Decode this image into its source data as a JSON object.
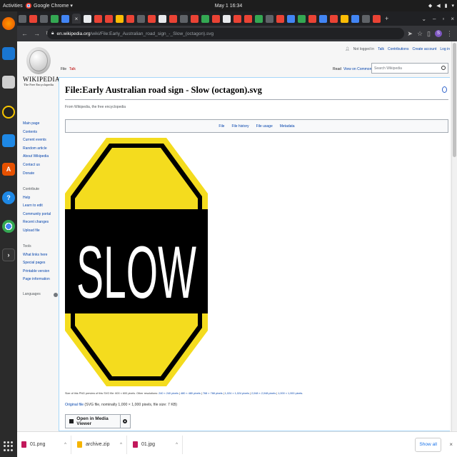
{
  "system": {
    "activities": "Activities",
    "app_name": "Google Chrome ▾",
    "clock": "May 1  16:34"
  },
  "browser": {
    "active_tab_close": "×",
    "new_tab": "+",
    "url_host": "en.wikipedia.org",
    "url_path": "/wiki/File:Early_Australian_road_sign_-_Slow_(octagon).svg",
    "profile_initial": "S"
  },
  "wiki": {
    "wordmark": "WIKIPEDIA",
    "tagline": "The Free Encyclopedia",
    "nav": [
      "Main page",
      "Contents",
      "Current events",
      "Random article",
      "About Wikipedia",
      "Contact us",
      "Donate"
    ],
    "contribute_heading": "Contribute",
    "contribute": [
      "Help",
      "Learn to edit",
      "Community portal",
      "Recent changes",
      "Upload file"
    ],
    "tools_heading": "Tools",
    "tools": [
      "What links here",
      "Special pages",
      "Printable version",
      "Page information"
    ],
    "languages_heading": "Languages",
    "personal": {
      "not_logged_in": "Not logged in",
      "talk": "Talk",
      "contributions": "Contributions",
      "create_account": "Create account",
      "log_in": "Log in"
    },
    "tab_file": "File",
    "tab_talk": "Talk",
    "tab_read": "Read",
    "tab_view_commons": "View on Commons",
    "search_placeholder": "Search Wikipedia",
    "title": "File:Early Australian road sign - Slow (octagon).svg",
    "from_line": "From Wikipedia, the free encyclopedia",
    "file_nav": [
      "File",
      "File history",
      "File usage",
      "Metadata"
    ],
    "sign_text": "SLOW",
    "info_prefix": "Size of this PNG preview of this SVG file: 600 × 600 pixels. Other resolutions: ",
    "resolutions": [
      "240 × 240 pixels",
      "480 × 480 pixels",
      "768 × 768 pixels",
      "1,024 × 1,024 pixels",
      "2,048 × 2,048 pixels",
      "1,000 × 1,000 pixels"
    ],
    "original_link": "Original file",
    "original_details": " (SVG file, nominally 1,000 × 1,000 pixels, file size: 7 KB)",
    "media_viewer_button": "Open in Media Viewer",
    "colors": {
      "sign_yellow": "#f4dc1e",
      "sign_black": "#000000",
      "link": "#0645ad"
    }
  },
  "downloads": {
    "items": [
      {
        "name": "01.png",
        "color": "#c2185b"
      },
      {
        "name": "archive.zip",
        "color": "#f5b400"
      },
      {
        "name": "01.jpg",
        "color": "#c2185b"
      }
    ],
    "show_all": "Show all",
    "close": "×"
  }
}
